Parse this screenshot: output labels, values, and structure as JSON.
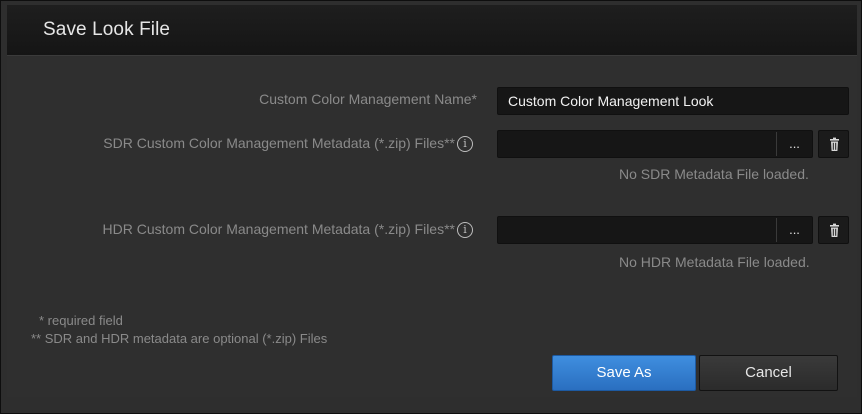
{
  "dialog": {
    "title": "Save Look File"
  },
  "fields": {
    "name": {
      "label": "Custom Color Management Name*",
      "value": "Custom Color Management Look"
    },
    "sdr": {
      "label": "SDR Custom Color Management Metadata (*.zip) Files**",
      "info_icon": "i",
      "value": "",
      "browse_label": "...",
      "status": "No SDR Metadata File loaded."
    },
    "hdr": {
      "label": "HDR Custom Color Management Metadata (*.zip) Files**",
      "info_icon": "i",
      "value": "",
      "browse_label": "...",
      "status": "No HDR Metadata File loaded."
    }
  },
  "notes": {
    "required": "* required field",
    "optional": "** SDR and HDR metadata are optional (*.zip) Files"
  },
  "buttons": {
    "save_as": "Save As",
    "cancel": "Cancel"
  },
  "colors": {
    "accent": "#3a85d6",
    "background": "#2f2f2f",
    "title_bar": "#1a1a1a"
  }
}
